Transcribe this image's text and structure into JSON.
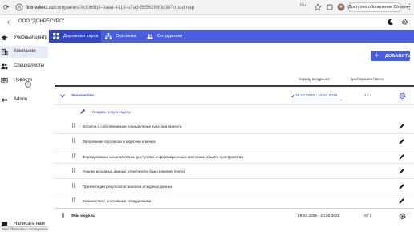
{
  "browser": {
    "url_host": "fininteliect.ru",
    "url_path": "/companies/3cf066b3-0aad-4119-b7ad-56562660e387/roadmap",
    "lang_badge": "Ru",
    "update_label": "Доступно обновление Chrome",
    "status_url": "https://fininteliect.ru/companies"
  },
  "header": {
    "company_title": "ООО \"ДОНРЕСУРС\""
  },
  "sidebar": {
    "items": [
      {
        "label": "Учебный центр",
        "icon": "graduation-icon"
      },
      {
        "label": "Компании",
        "icon": "building-icon"
      },
      {
        "label": "Специалисты",
        "icon": "people-icon"
      },
      {
        "label": "Новости",
        "icon": "news-icon"
      },
      {
        "label": "Admin",
        "icon": "admin-icon"
      }
    ],
    "write_us": "Написать нам"
  },
  "tabs": [
    {
      "label": "Дорожная карта",
      "icon": "grid-icon"
    },
    {
      "label": "Оргсхема",
      "icon": "org-chart-icon"
    },
    {
      "label": "Сотрудники",
      "icon": "people-icon"
    }
  ],
  "actions": {
    "add_label": "ДОБАВИТЬ"
  },
  "table": {
    "col_period": "период внедрения",
    "col_days": "дней прошло / всего",
    "group": {
      "name": "Знакомство",
      "period": "18.02.2025 - 19.02.2025",
      "days": "1 / 1"
    },
    "create_task": "Создать новую задачу",
    "tasks": [
      "Встреча с собственником, определение куратора проекта",
      "Заполнение протокола и карточки клиента",
      "Формирование каналов связи, доступов к информационным системам, общего пространства",
      "Анализ исходных данных (отчетности, базы ведения учета)",
      "Презентация результатов анализа исходных данных",
      "Знакомство с ключевыми сотрудниками"
    ],
    "group2": {
      "name": "Фин модель",
      "period": "19.02.2025 - 20.02.2025",
      "days": "0 / 1"
    }
  },
  "colors": {
    "accent": "#4a5ee0",
    "accent_dark": "#3345c8"
  }
}
